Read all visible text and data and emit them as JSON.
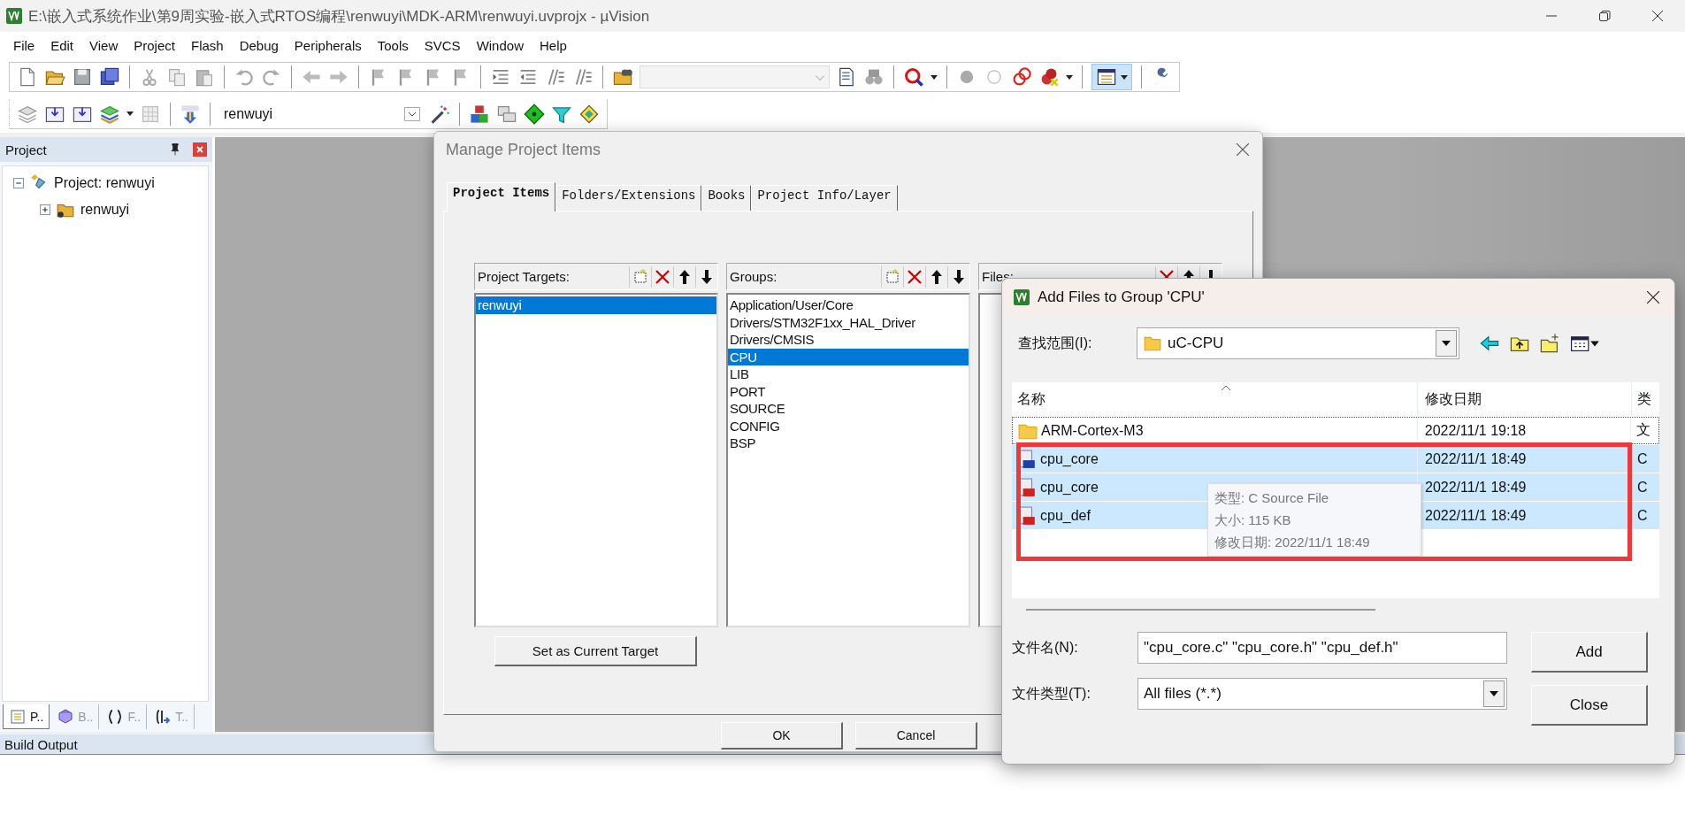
{
  "window": {
    "title": "E:\\嵌入式系统作业\\第9周实验-嵌入式RTOS编程\\renwuyi\\MDK-ARM\\renwuyi.uvprojx - µVision"
  },
  "menu": [
    "File",
    "Edit",
    "View",
    "Project",
    "Flash",
    "Debug",
    "Peripherals",
    "Tools",
    "SVCS",
    "Window",
    "Help"
  ],
  "target_combo": {
    "value": "renwuyi"
  },
  "project_panel": {
    "title": "Project",
    "tree": [
      {
        "label": "Project: renwuyi",
        "expanded": true,
        "children": [
          {
            "label": "renwuyi",
            "expanded": false
          }
        ]
      }
    ],
    "tabs": [
      {
        "label": "P..",
        "selected": true
      },
      {
        "label": "B..",
        "selected": false
      },
      {
        "label": "F..",
        "selected": false
      },
      {
        "label": "T..",
        "selected": false
      }
    ]
  },
  "build_output": {
    "title": "Build Output"
  },
  "manage_dialog": {
    "title": "Manage Project Items",
    "tabs": [
      {
        "label": "Project Items",
        "selected": true
      },
      {
        "label": "Folders/Extensions",
        "selected": false
      },
      {
        "label": "Books",
        "selected": false
      },
      {
        "label": "Project Info/Layer",
        "selected": false
      }
    ],
    "lists": [
      {
        "kind": "targets",
        "title": "Project Targets:",
        "items": [
          {
            "label": "renwuyi",
            "selected": true
          }
        ]
      },
      {
        "kind": "groups",
        "title": "Groups:",
        "items": [
          {
            "label": "Application/User/Core",
            "selected": false
          },
          {
            "label": "Drivers/STM32F1xx_HAL_Driver",
            "selected": false
          },
          {
            "label": "Drivers/CMSIS",
            "selected": false
          },
          {
            "label": "CPU",
            "selected": true
          },
          {
            "label": "LIB",
            "selected": false
          },
          {
            "label": "PORT",
            "selected": false
          },
          {
            "label": "SOURCE",
            "selected": false
          },
          {
            "label": "CONFIG",
            "selected": false
          },
          {
            "label": "BSP",
            "selected": false
          }
        ]
      },
      {
        "kind": "files",
        "title": "Files:"
      }
    ],
    "target_button": "Set as Current Target",
    "buttons": [
      "OK",
      "Cancel"
    ]
  },
  "add_files_dialog": {
    "title": "Add Files to Group 'CPU'",
    "look_in": {
      "label": "查找范围(I):",
      "value": "uC-CPU"
    },
    "columns": [
      "名称",
      "修改日期",
      "类"
    ],
    "files": [
      {
        "kind": "folder",
        "name": "ARM-Cortex-M3",
        "date": "2022/11/1 19:18",
        "type": "文",
        "selected": false
      },
      {
        "kind": "c",
        "name": "cpu_core",
        "date": "2022/11/1 18:49",
        "type": "C",
        "selected": true
      },
      {
        "kind": "h",
        "name": "cpu_core",
        "date": "2022/11/1 18:49",
        "type": "C",
        "selected": true
      },
      {
        "kind": "h",
        "name": "cpu_def",
        "date": "2022/11/1 18:49",
        "type": "C",
        "selected": true
      }
    ],
    "tooltip": [
      "类型: C Source File",
      "大小: 115 KB",
      "修改日期: 2022/11/1 18:49"
    ],
    "filename": {
      "label": "文件名(N):",
      "value": "\"cpu_core.c\" \"cpu_core.h\" \"cpu_def.h\""
    },
    "filetype": {
      "label": "文件类型(T):",
      "value": "All files (*.*)"
    },
    "buttons": [
      "Add",
      "Close"
    ]
  }
}
